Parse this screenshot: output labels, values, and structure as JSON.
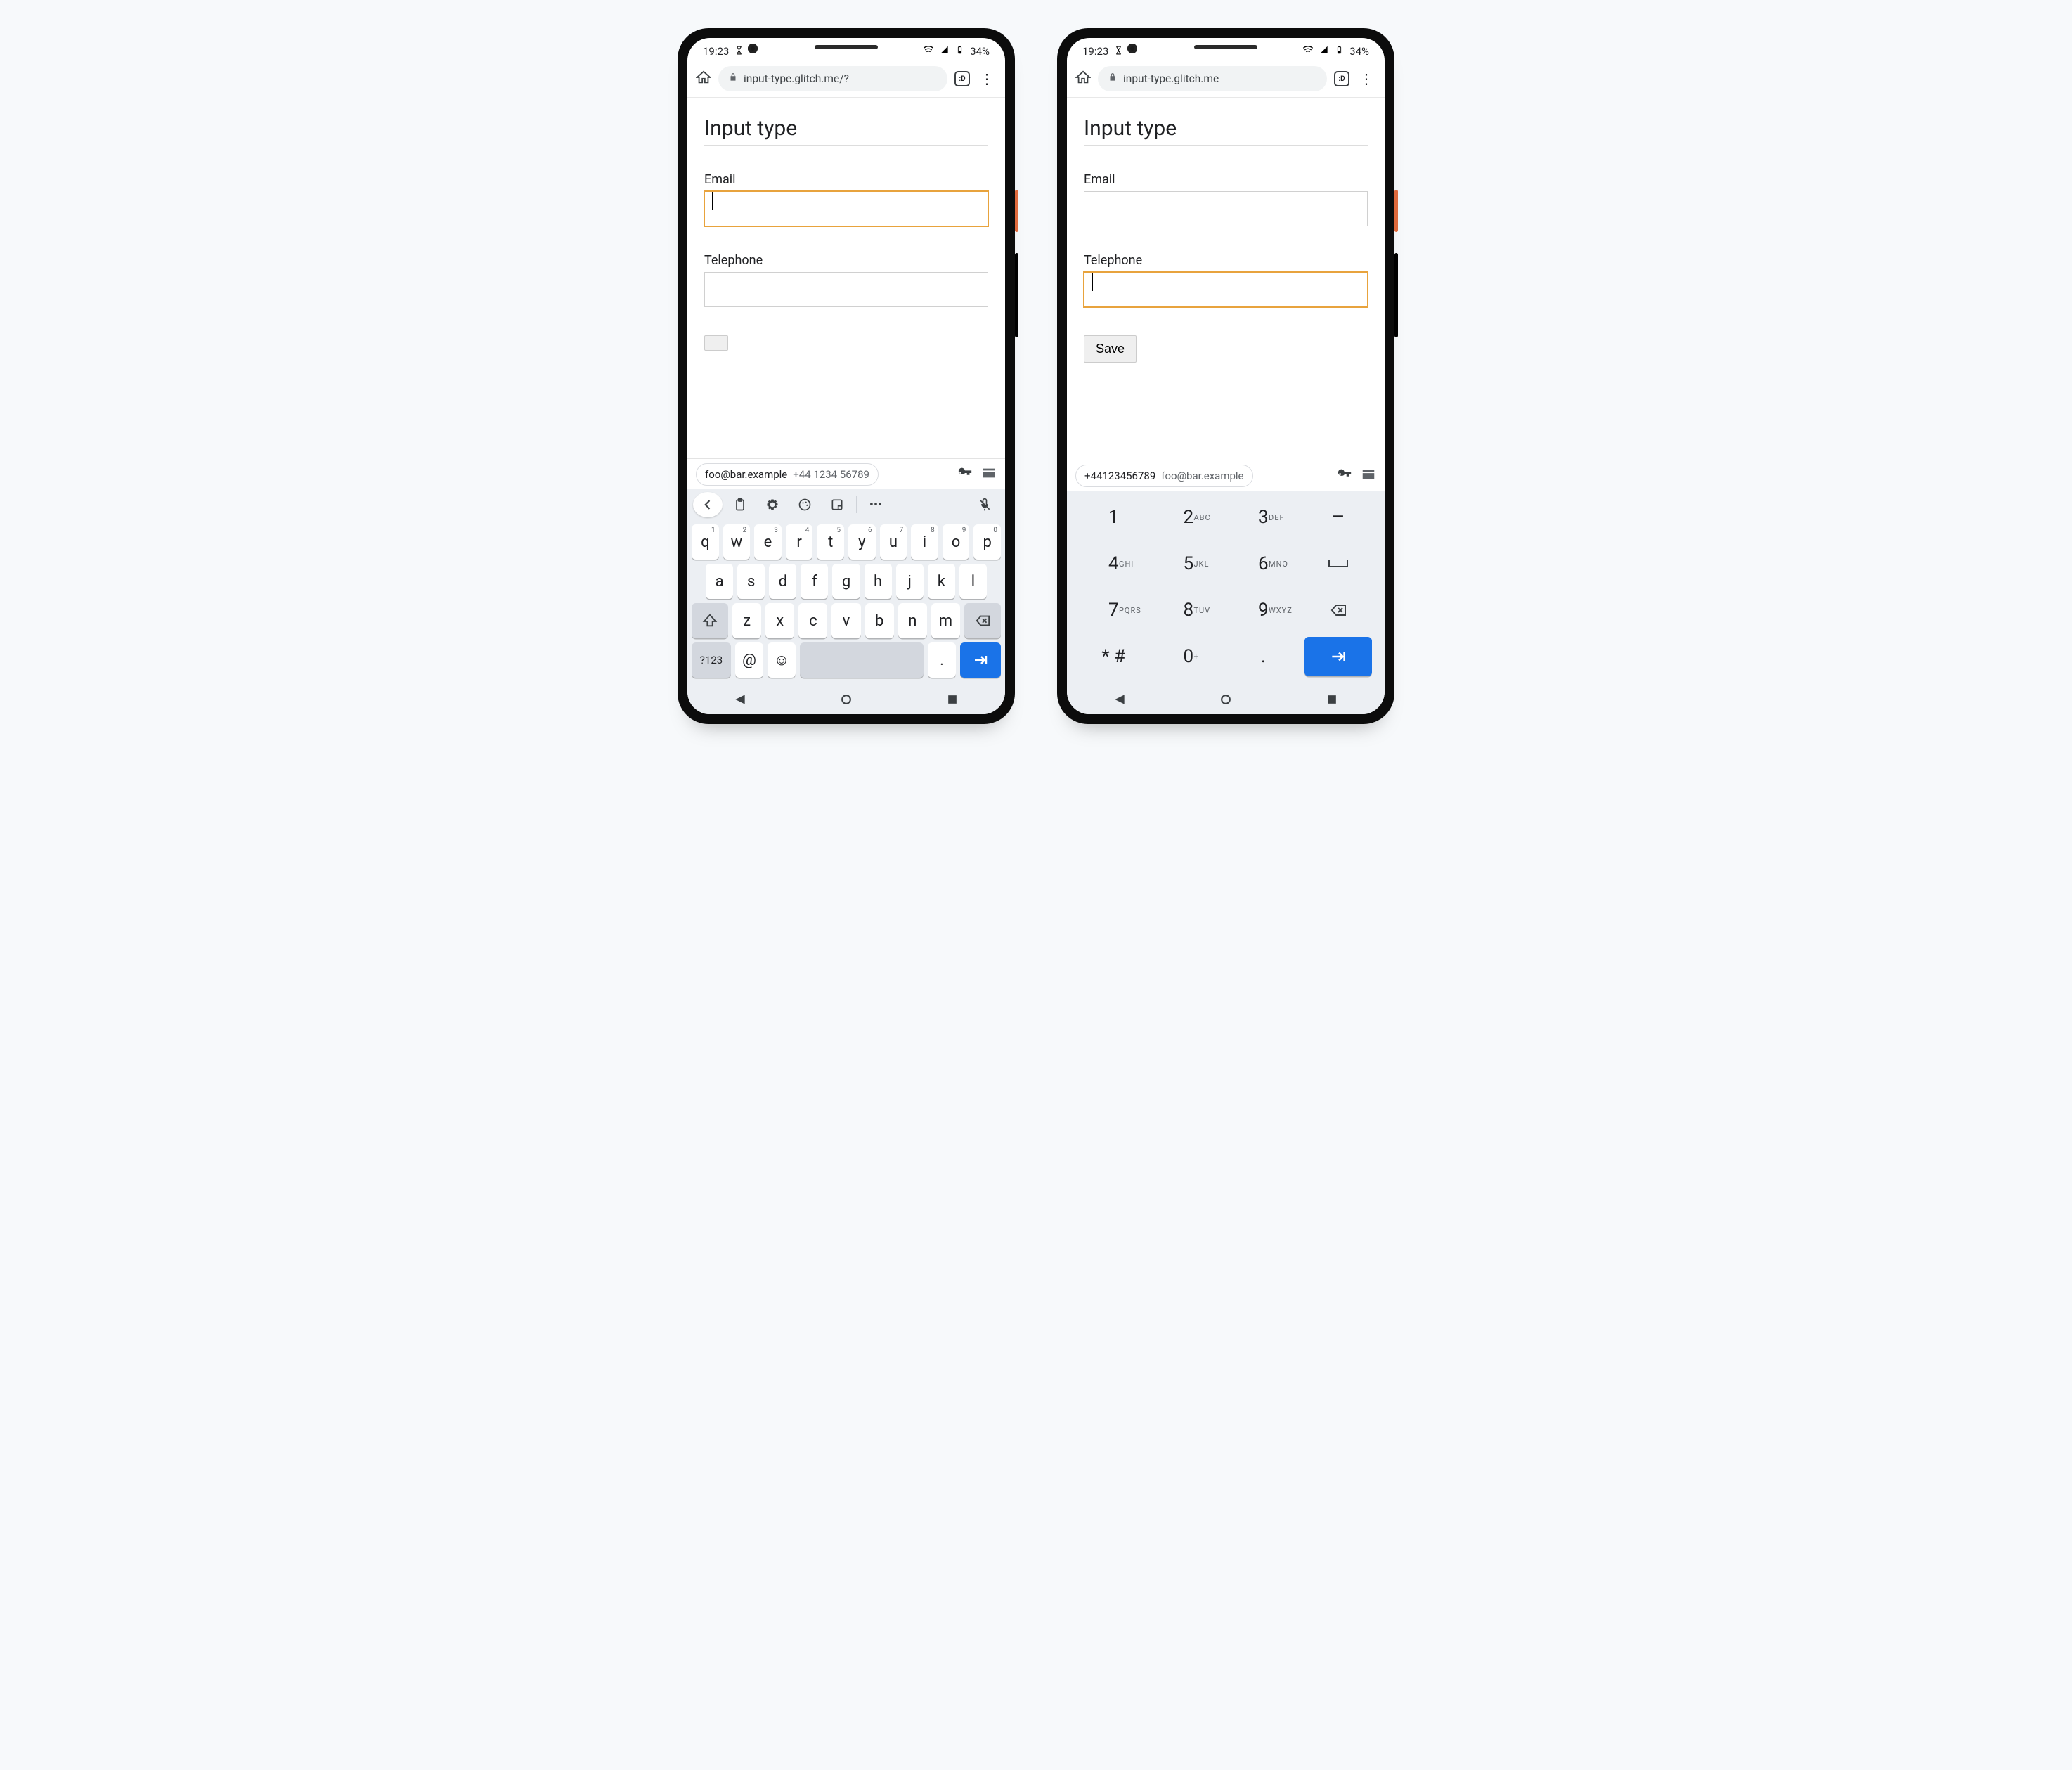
{
  "status": {
    "time": "19:23",
    "battery_pct": "34%"
  },
  "chrome": {
    "url_left": "input-type.glitch.me/?",
    "url_right": "input-type.glitch.me",
    "tab_glyph": ":D"
  },
  "page": {
    "heading": "Input type",
    "email_label": "Email",
    "tel_label": "Telephone",
    "save_label": "Save"
  },
  "autofill": {
    "email": "foo@bar.example",
    "phone": "+44 1234 56789",
    "phone_compact": "+44123456789"
  },
  "qwerty": {
    "row1": [
      {
        "k": "q",
        "n": "1"
      },
      {
        "k": "w",
        "n": "2"
      },
      {
        "k": "e",
        "n": "3"
      },
      {
        "k": "r",
        "n": "4"
      },
      {
        "k": "t",
        "n": "5"
      },
      {
        "k": "y",
        "n": "6"
      },
      {
        "k": "u",
        "n": "7"
      },
      {
        "k": "i",
        "n": "8"
      },
      {
        "k": "o",
        "n": "9"
      },
      {
        "k": "p",
        "n": "0"
      }
    ],
    "row2": [
      "a",
      "s",
      "d",
      "f",
      "g",
      "h",
      "j",
      "k",
      "l"
    ],
    "row3": [
      "z",
      "x",
      "c",
      "v",
      "b",
      "n",
      "m"
    ],
    "sym_key": "?123",
    "at_key": "@",
    "dot_key": "."
  },
  "numpad": {
    "rows": [
      [
        {
          "d": "1"
        },
        {
          "d": "2",
          "l": "ABC"
        },
        {
          "d": "3",
          "l": "DEF"
        },
        {
          "sym": "dash"
        }
      ],
      [
        {
          "d": "4",
          "l": "GHI"
        },
        {
          "d": "5",
          "l": "JKL"
        },
        {
          "d": "6",
          "l": "MNO"
        },
        {
          "sym": "space"
        }
      ],
      [
        {
          "d": "7",
          "l": "PQRS"
        },
        {
          "d": "8",
          "l": "TUV"
        },
        {
          "d": "9",
          "l": "WXYZ"
        },
        {
          "sym": "bksp"
        }
      ],
      [
        {
          "d": "* #"
        },
        {
          "d": "0",
          "l": "+"
        },
        {
          "d": "."
        },
        {
          "sym": "enter"
        }
      ]
    ]
  }
}
